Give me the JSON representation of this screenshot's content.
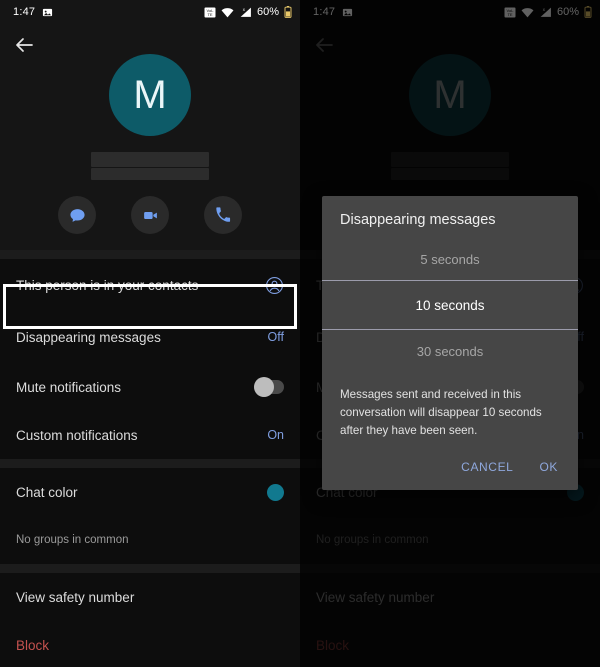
{
  "status_bar": {
    "time": "1:47",
    "battery": "60%",
    "icons": [
      "image-icon",
      "volte-icon",
      "wifi-icon",
      "cellular-signal-icon",
      "battery-icon"
    ]
  },
  "header": {
    "back_icon": "back-arrow-icon",
    "avatar_initial": "M",
    "avatar_color": "#0d5b68",
    "contact_name_redacted": true,
    "actions": [
      {
        "name": "message-action-button",
        "icon": "message-bubble-icon"
      },
      {
        "name": "video-call-action-button",
        "icon": "video-camera-icon"
      },
      {
        "name": "voice-call-action-button",
        "icon": "phone-icon"
      }
    ]
  },
  "settings": {
    "contacts_row": {
      "label": "This person is in your contacts",
      "icon": "contact-person-icon"
    },
    "disappearing_messages": {
      "label": "Disappearing messages",
      "value": "Off",
      "highlighted": true
    },
    "mute_notifications": {
      "label": "Mute notifications",
      "toggle": "off"
    },
    "custom_notifications": {
      "label": "Custom notifications",
      "value": "On"
    },
    "chat_color": {
      "label": "Chat color",
      "swatch": "#11798f"
    },
    "groups_in_common": {
      "label": "No groups in common"
    },
    "safety_number": {
      "label": "View safety number"
    },
    "block": {
      "label": "Block",
      "color": "#c4524f"
    }
  },
  "dialog": {
    "title": "Disappearing messages",
    "options": [
      {
        "label": "5 seconds",
        "selected": false
      },
      {
        "label": "10 seconds",
        "selected": true
      },
      {
        "label": "30 seconds",
        "selected": false
      }
    ],
    "description": "Messages sent and received in this conversation will disappear 10 seconds after they have been seen.",
    "cancel_label": "CANCEL",
    "ok_label": "OK",
    "accent": "#8fa8dd"
  },
  "accent_blue": "#7f9ee0"
}
